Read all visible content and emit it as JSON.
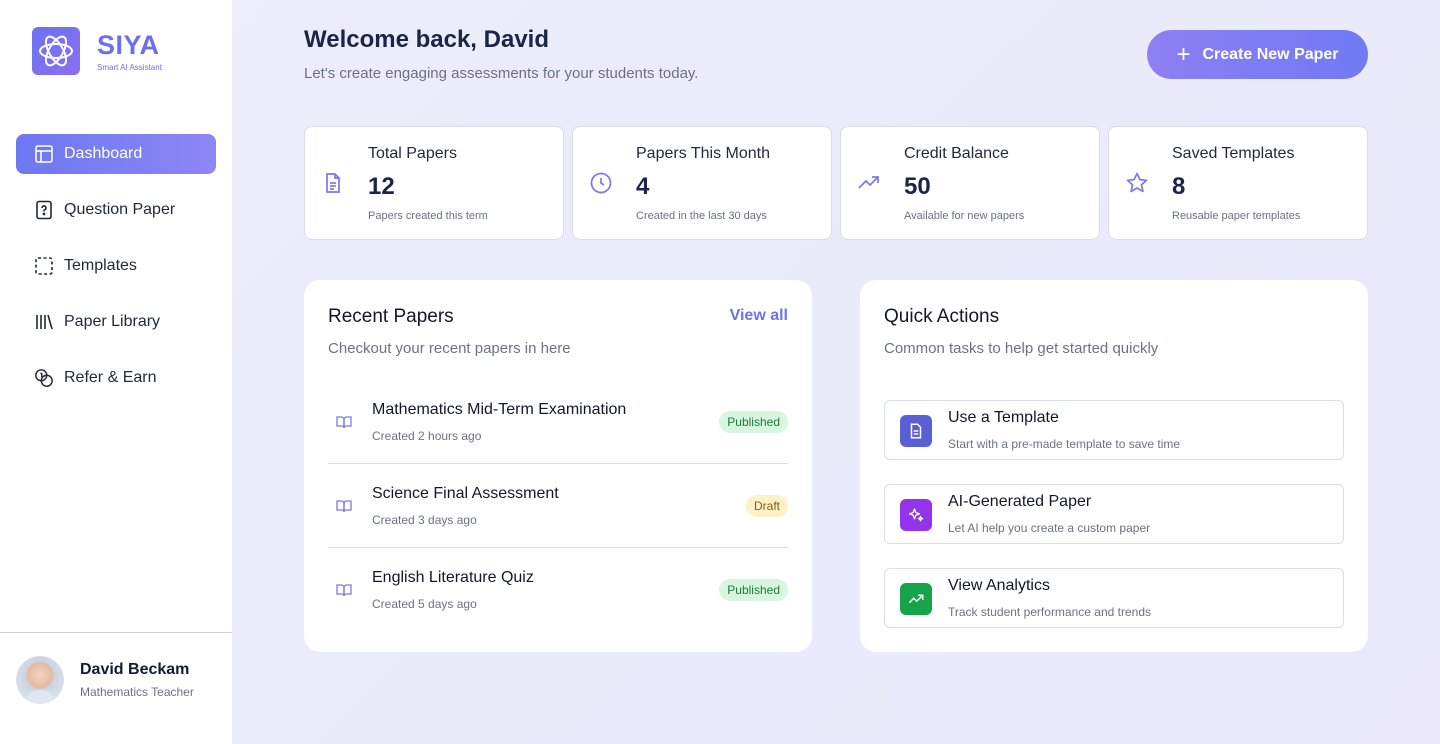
{
  "brand": {
    "name": "SIYA",
    "tagline": "Smart AI Assistant",
    "accent": "#6c6ef0"
  },
  "sidebar": {
    "items": [
      {
        "label": "Dashboard",
        "icon": "layout-icon",
        "active": true
      },
      {
        "label": "Question Paper",
        "icon": "question-file-icon"
      },
      {
        "label": "Templates",
        "icon": "dashed-square-icon"
      },
      {
        "label": "Paper Library",
        "icon": "library-icon"
      },
      {
        "label": "Refer & Earn",
        "icon": "coins-icon"
      }
    ]
  },
  "profile": {
    "name": "David Beckam",
    "role": "Mathematics Teacher"
  },
  "header": {
    "title": "Welcome back, David",
    "subtitle": "Let's create engaging assessments for your students today.",
    "create_label": "Create New Paper"
  },
  "stats": [
    {
      "label": "Total Papers",
      "value": "12",
      "desc": "Papers created this term",
      "icon": "document-icon"
    },
    {
      "label": "Papers This Month",
      "value": "4",
      "desc": "Created in the last 30 days",
      "icon": "clock-icon"
    },
    {
      "label": "Credit Balance",
      "value": "50",
      "desc": "Available for new papers",
      "icon": "trending-up-icon"
    },
    {
      "label": "Saved Templates",
      "value": "8",
      "desc": "Reusable paper templates",
      "icon": "star-icon"
    }
  ],
  "recent": {
    "title": "Recent Papers",
    "subtitle": "Checkout your recent papers in here",
    "view_all": "View all",
    "papers": [
      {
        "title": "Mathematics Mid-Term Examination",
        "time": "Created 2 hours ago",
        "status": "Published"
      },
      {
        "title": "Science Final Assessment",
        "time": "Created 3 days ago",
        "status": "Draft"
      },
      {
        "title": "English Literature Quiz",
        "time": "Created 5 days ago",
        "status": "Published"
      }
    ]
  },
  "quick": {
    "title": "Quick Actions",
    "subtitle": "Common tasks to help get started quickly",
    "actions": [
      {
        "title": "Use a Template",
        "desc": "Start with a pre-made template to save time",
        "icon": "document-icon",
        "color": "#5b5fd6"
      },
      {
        "title": "AI-Generated Paper",
        "desc": "Let AI help you create a custom paper",
        "icon": "sparkles-icon",
        "color": "#9333ea"
      },
      {
        "title": "View Analytics",
        "desc": "Track student performance and trends",
        "icon": "trending-up-icon",
        "color": "#16a34a"
      }
    ]
  }
}
